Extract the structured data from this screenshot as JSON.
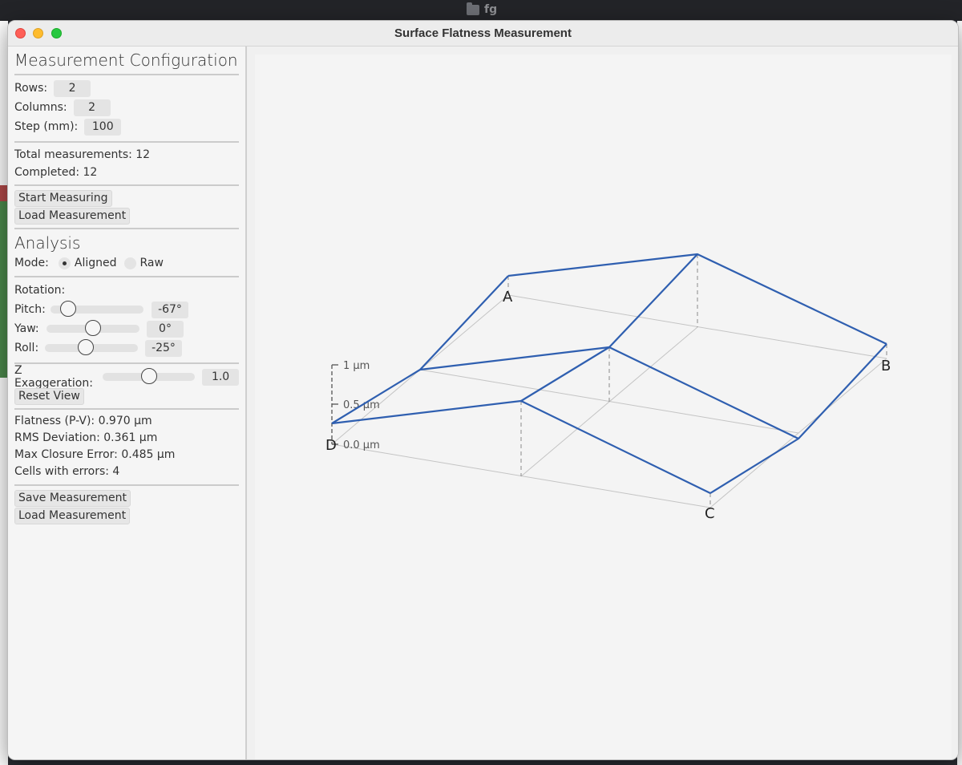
{
  "desktop": {
    "title": "fg"
  },
  "window": {
    "title": "Surface Flatness Measurement"
  },
  "config": {
    "title": "Measurement Configuration",
    "rows_label": "Rows:",
    "rows_value": "2",
    "columns_label": "Columns:",
    "columns_value": "2",
    "step_label": "Step (mm):",
    "step_value": "100",
    "total_label": "Total measurements: 12",
    "completed_label": "Completed: 12",
    "start_button": "Start Measuring",
    "load_button": "Load Measurement"
  },
  "analysis": {
    "title": "Analysis",
    "mode_label": "Mode:",
    "mode_options": [
      "Aligned",
      "Raw"
    ],
    "mode_selected": "Aligned",
    "rotation_label": "Rotation:",
    "pitch_label": "Pitch:",
    "pitch_value": "-67°",
    "pitch_fraction": 0.12,
    "yaw_label": "Yaw:",
    "yaw_value": "0°",
    "yaw_fraction": 0.5,
    "roll_label": "Roll:",
    "roll_value": "-25°",
    "roll_fraction": 0.43,
    "zexag_label": "Z Exaggeration:",
    "zexag_value": "1.0",
    "zexag_fraction": 0.5,
    "reset_button": "Reset View"
  },
  "results": {
    "flatness": "Flatness (P-V): 0.970 µm",
    "rms": "RMS Deviation: 0.361 µm",
    "closure": "Max Closure Error: 0.485 µm",
    "cells": "Cells with errors: 4",
    "save_button": "Save Measurement",
    "load_button": "Load Measurement"
  },
  "viewer": {
    "corner_labels": [
      "A",
      "B",
      "C",
      "D"
    ],
    "scale_labels": [
      "1 µm",
      "0.5 µm",
      "0.0 µm"
    ],
    "line_color": "#2f5fb0"
  }
}
